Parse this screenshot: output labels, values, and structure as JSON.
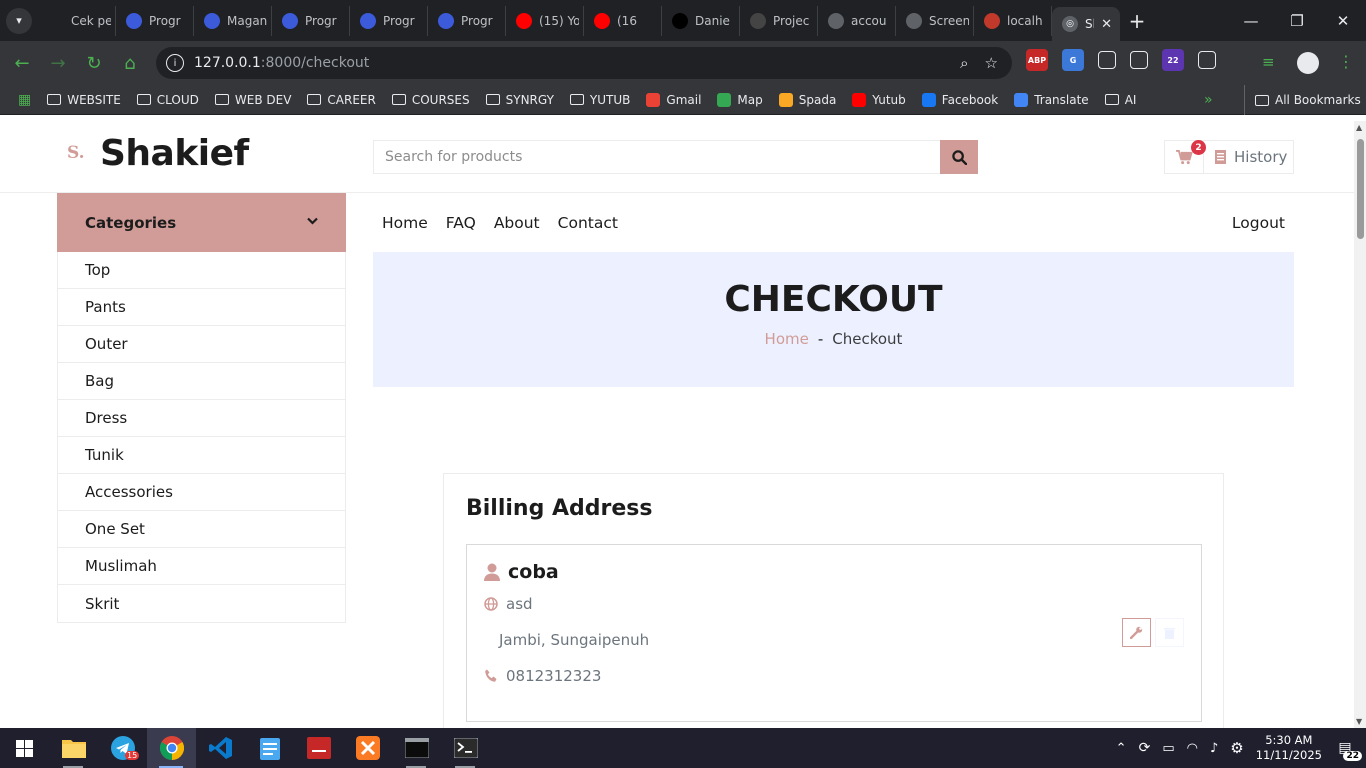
{
  "browser": {
    "tabs": [
      {
        "title": "Cek pe",
        "color": "#202124"
      },
      {
        "title": "Progr",
        "color": "#3b5bdb"
      },
      {
        "title": "Magan",
        "color": "#3b5bdb"
      },
      {
        "title": "Progr",
        "color": "#3b5bdb"
      },
      {
        "title": "Progr",
        "color": "#3b5bdb"
      },
      {
        "title": "Progr",
        "color": "#3b5bdb"
      },
      {
        "title": "(15) Yo",
        "color": "#ff0000"
      },
      {
        "title": "(16",
        "color": "#ff0000"
      },
      {
        "title": "Danie",
        "color": "#000000"
      },
      {
        "title": "Projec",
        "color": "#444444"
      },
      {
        "title": "accou",
        "color": "#5f6368"
      },
      {
        "title": "Screen",
        "color": "#5f6368"
      },
      {
        "title": "localh",
        "color": "#c0392b"
      }
    ],
    "active_tab": {
      "title": "Sh"
    },
    "url_host": "127.0.0.1",
    "url_path": ":8000/checkout",
    "extensions": [
      {
        "label": "ABP",
        "color": "#c62828"
      },
      {
        "label": "G",
        "color": "#3c78d8"
      },
      {
        "label": "",
        "color": "#35363a"
      },
      {
        "label": "",
        "color": "#35363a"
      },
      {
        "label": "22",
        "color": "#5e35b1"
      },
      {
        "label": "",
        "color": "#35363a"
      }
    ],
    "bookmarks": [
      {
        "label": "WEBSITE",
        "type": "folder"
      },
      {
        "label": "CLOUD",
        "type": "folder"
      },
      {
        "label": "WEB DEV",
        "type": "folder"
      },
      {
        "label": "CAREER",
        "type": "folder"
      },
      {
        "label": "COURSES",
        "type": "folder"
      },
      {
        "label": "SYNRGY",
        "type": "folder"
      },
      {
        "label": "YUTUB",
        "type": "folder"
      },
      {
        "label": "Gmail",
        "type": "site",
        "color": "#ea4335"
      },
      {
        "label": "Map",
        "type": "site",
        "color": "#34a853"
      },
      {
        "label": "Spada",
        "type": "site",
        "color": "#f9a825"
      },
      {
        "label": "Yutub",
        "type": "site",
        "color": "#ff0000"
      },
      {
        "label": "Facebook",
        "type": "site",
        "color": "#1877f2"
      },
      {
        "label": "Translate",
        "type": "site",
        "color": "#4285f4"
      },
      {
        "label": "AI",
        "type": "folder"
      }
    ],
    "all_bookmarks": "All Bookmarks"
  },
  "site": {
    "logo_mark": "S.",
    "logo_text": "Shakief",
    "search_placeholder": "Search for products",
    "cart_count": "2",
    "history_label": "History",
    "accent": "#d19c97"
  },
  "sidebar": {
    "title": "Categories",
    "items": [
      "Top",
      "Pants",
      "Outer",
      "Bag",
      "Dress",
      "Tunik",
      "Accessories",
      "One Set",
      "Muslimah",
      "Skrit"
    ]
  },
  "nav": {
    "links": [
      "Home",
      "FAQ",
      "About",
      "Contact"
    ],
    "logout": "Logout"
  },
  "banner": {
    "title": "CHECKOUT",
    "crumb_home": "Home",
    "crumb_sep": "-",
    "crumb_current": "Checkout"
  },
  "billing": {
    "title": "Billing Address",
    "name": "coba",
    "country": "asd",
    "city": "Jambi, Sungaipenuh",
    "phone": "0812312323"
  },
  "taskbar": {
    "time": "5:30 AM",
    "date": "11/11/2025",
    "notifications": "22",
    "telegram_badge": "15"
  }
}
